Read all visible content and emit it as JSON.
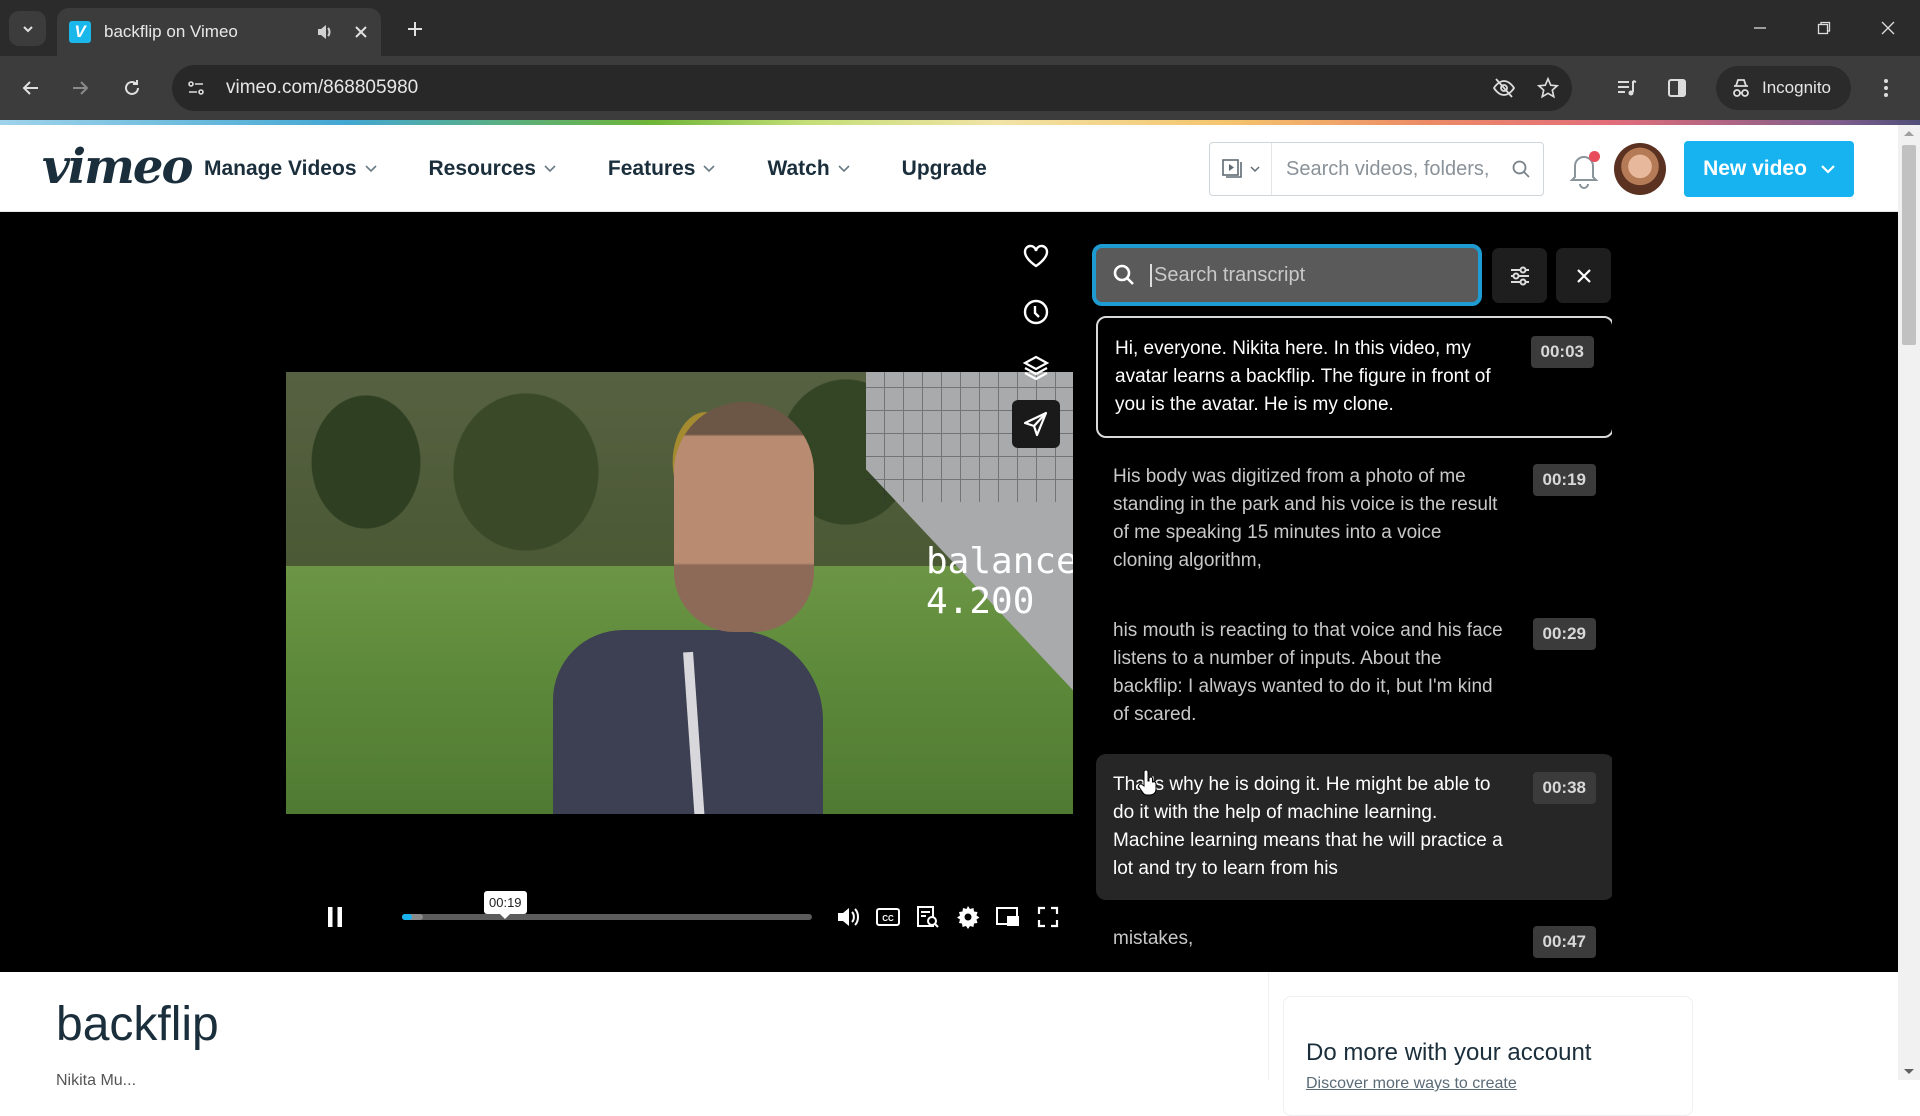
{
  "browser": {
    "tab_title": "backflip on Vimeo",
    "favicon_letter": "V",
    "url": "vimeo.com/868805980",
    "profile_label": "Incognito",
    "icons": [
      "tab-search-icon",
      "speaker-icon",
      "close-icon",
      "plus-icon",
      "back-icon",
      "forward-icon",
      "reload-icon",
      "site-settings-icon",
      "eye-off-icon",
      "star-icon",
      "media-controls-icon",
      "side-panel-icon",
      "incognito-icon",
      "kebab-menu-icon",
      "minimize-icon",
      "restore-icon",
      "close-window-icon"
    ]
  },
  "header": {
    "logo": "vimeo",
    "nav": [
      {
        "label": "Manage Videos",
        "has_dropdown": true
      },
      {
        "label": "Resources",
        "has_dropdown": true
      },
      {
        "label": "Features",
        "has_dropdown": true
      },
      {
        "label": "Watch",
        "has_dropdown": true
      },
      {
        "label": "Upgrade",
        "has_dropdown": false
      }
    ],
    "search_placeholder": "Search videos, folders,",
    "notification_dot": true,
    "new_video_label": "New video",
    "brand_color": "#17b3f0"
  },
  "player": {
    "overlay_text_line1": "balance",
    "overlay_text_line2": "4.200",
    "side_actions": [
      "like",
      "watch-later",
      "collections",
      "share"
    ],
    "state": "playing",
    "hover_time": "00:19",
    "progress_fraction": 0.025,
    "buffered_fraction": 0.05,
    "controls": [
      "volume",
      "captions",
      "transcript",
      "settings",
      "picture-in-picture",
      "fullscreen"
    ]
  },
  "transcript": {
    "search_placeholder": "Search transcript",
    "search_accent": "#1e9bd0",
    "items": [
      {
        "time": "00:03",
        "text": "Hi, everyone. Nikita here. In this video, my avatar learns a backflip. The figure in front of you is the avatar. He is my clone.",
        "state": "current"
      },
      {
        "time": "00:19",
        "text": "His body was digitized from a photo of me standing in the park and his voice is the result of me speaking 15 minutes into a voice cloning algorithm,",
        "state": "normal"
      },
      {
        "time": "00:29",
        "text": "his mouth is reacting to that voice and his face listens to a number of inputs. About the backflip: I always wanted to do it, but I'm kind of scared.",
        "state": "normal"
      },
      {
        "time": "00:38",
        "text": "That's why he is doing it. He might be able to do it with the help of machine learning. Machine learning means that he will practice a lot and try to learn from his",
        "state": "hovered"
      },
      {
        "time": "00:47",
        "text": "mistakes,",
        "state": "normal"
      }
    ]
  },
  "below": {
    "video_title": "backflip",
    "byline": "Nikita Mu...",
    "promo_title": "Do more with your account",
    "promo_link": "Discover more ways to create"
  }
}
